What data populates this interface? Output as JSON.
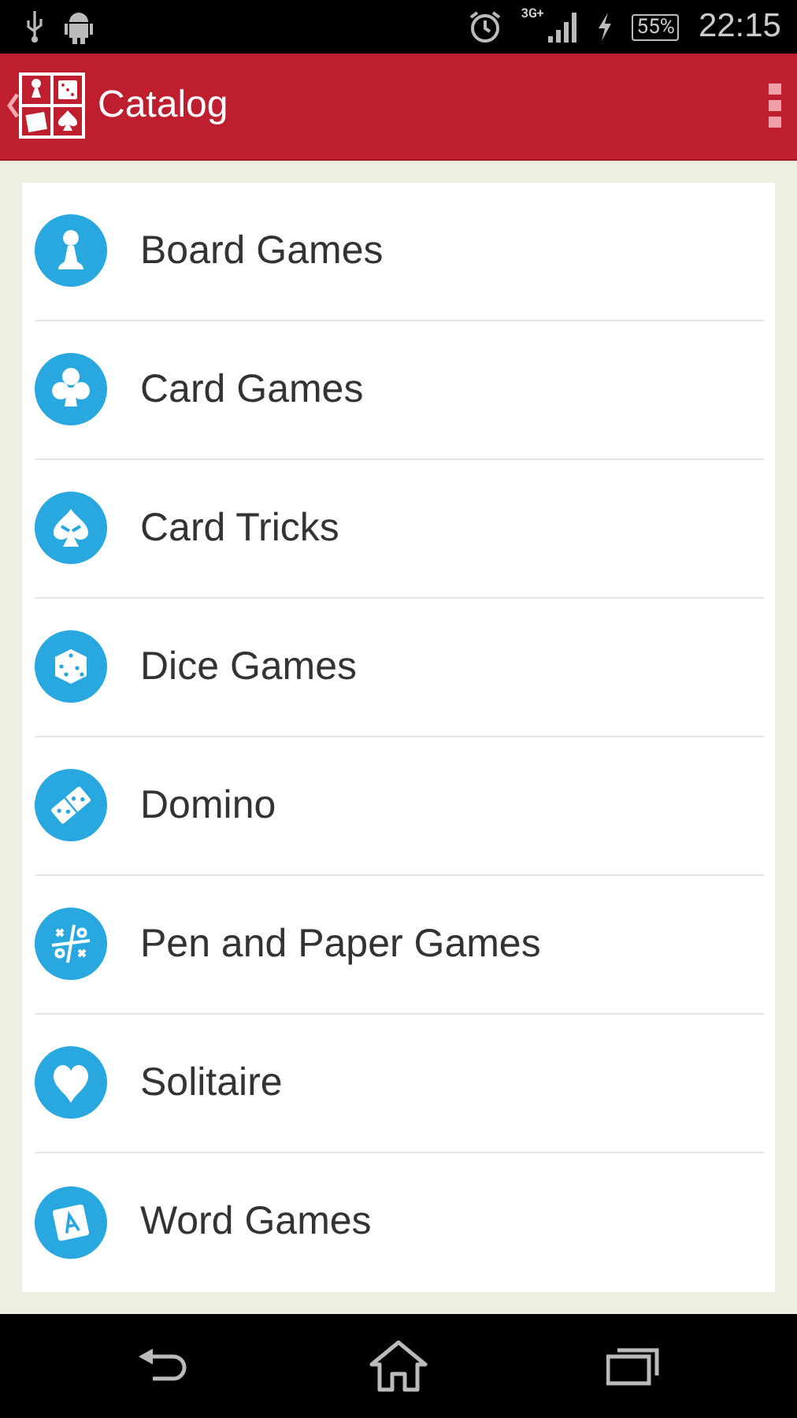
{
  "status_bar": {
    "network": "3G+",
    "battery": "55%",
    "time": "22:15"
  },
  "app_bar": {
    "title": "Catalog"
  },
  "items": [
    {
      "label": "Board Games",
      "kind": "pawn"
    },
    {
      "label": "Card Games",
      "kind": "club"
    },
    {
      "label": "Card Tricks",
      "kind": "spade"
    },
    {
      "label": "Dice Games",
      "kind": "dice"
    },
    {
      "label": "Domino",
      "kind": "domino"
    },
    {
      "label": "Pen and Paper Games",
      "kind": "tictactoe"
    },
    {
      "label": "Solitaire",
      "kind": "heart"
    },
    {
      "label": "Word Games",
      "kind": "tile"
    }
  ]
}
